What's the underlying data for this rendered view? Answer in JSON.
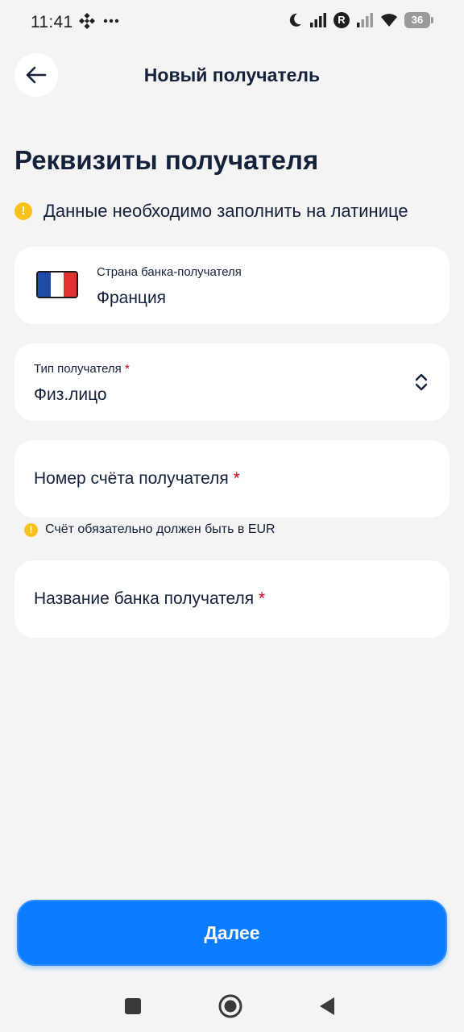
{
  "status_bar": {
    "time": "11:41",
    "battery": "36"
  },
  "header": {
    "title": "Новый получатель"
  },
  "section": {
    "title": "Реквизиты получателя",
    "notice": "Данные необходимо заполнить на латинице"
  },
  "form": {
    "country": {
      "label": "Страна банка-получателя",
      "value": "Франция",
      "flag_colors": [
        "#1f4aa8",
        "#ffffff",
        "#e0322e"
      ]
    },
    "recipient_type": {
      "label": "Тип получателя",
      "required_mark": "*",
      "value": "Физ.лицо"
    },
    "account_number": {
      "label": "Номер счёта получателя",
      "required_mark": "*",
      "hint": "Счёт обязательно должен быть в EUR"
    },
    "bank_name": {
      "label": "Название банка получателя",
      "required_mark": "*"
    }
  },
  "actions": {
    "next_label": "Далее"
  },
  "colors": {
    "accent": "#0b7cff",
    "warning": "#f7c21a",
    "required": "#d0021b",
    "background": "#f4f4f4"
  }
}
